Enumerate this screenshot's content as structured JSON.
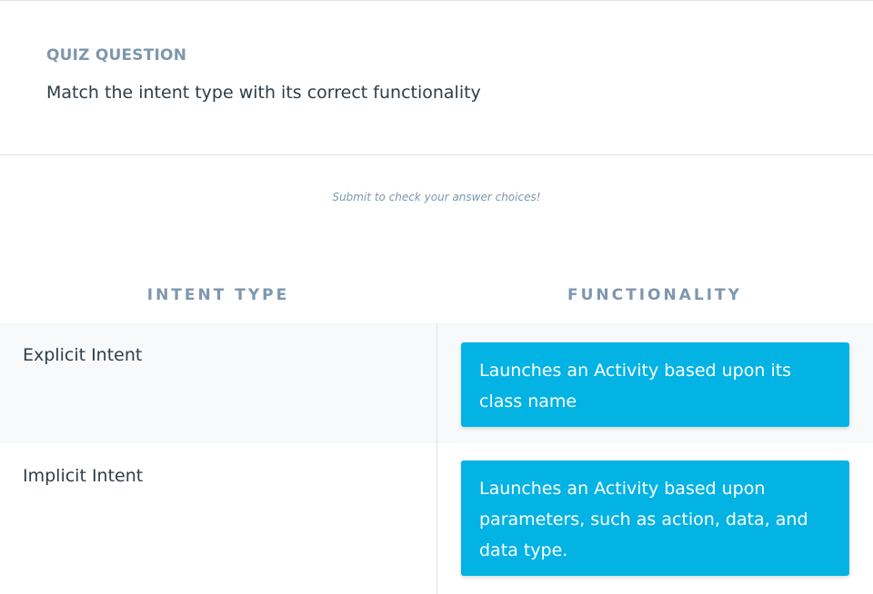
{
  "quiz": {
    "label": "QUIZ QUESTION",
    "question": "Match the intent type with its correct functionality",
    "hint": "Submit to check your answer choices!"
  },
  "columns": {
    "left_header": "INTENT TYPE",
    "right_header": "FUNCTIONALITY"
  },
  "rows": [
    {
      "term": "Explicit Intent",
      "answer": "Launches an Activity based upon its class name"
    },
    {
      "term": "Implicit Intent",
      "answer": "Launches an Activity based upon parameters, such as action, data, and data type."
    }
  ],
  "colors": {
    "accent": "#02b3e4",
    "label": "#7d97ad",
    "text": "#2e3d49",
    "row_alt": "#f8f9fb"
  }
}
